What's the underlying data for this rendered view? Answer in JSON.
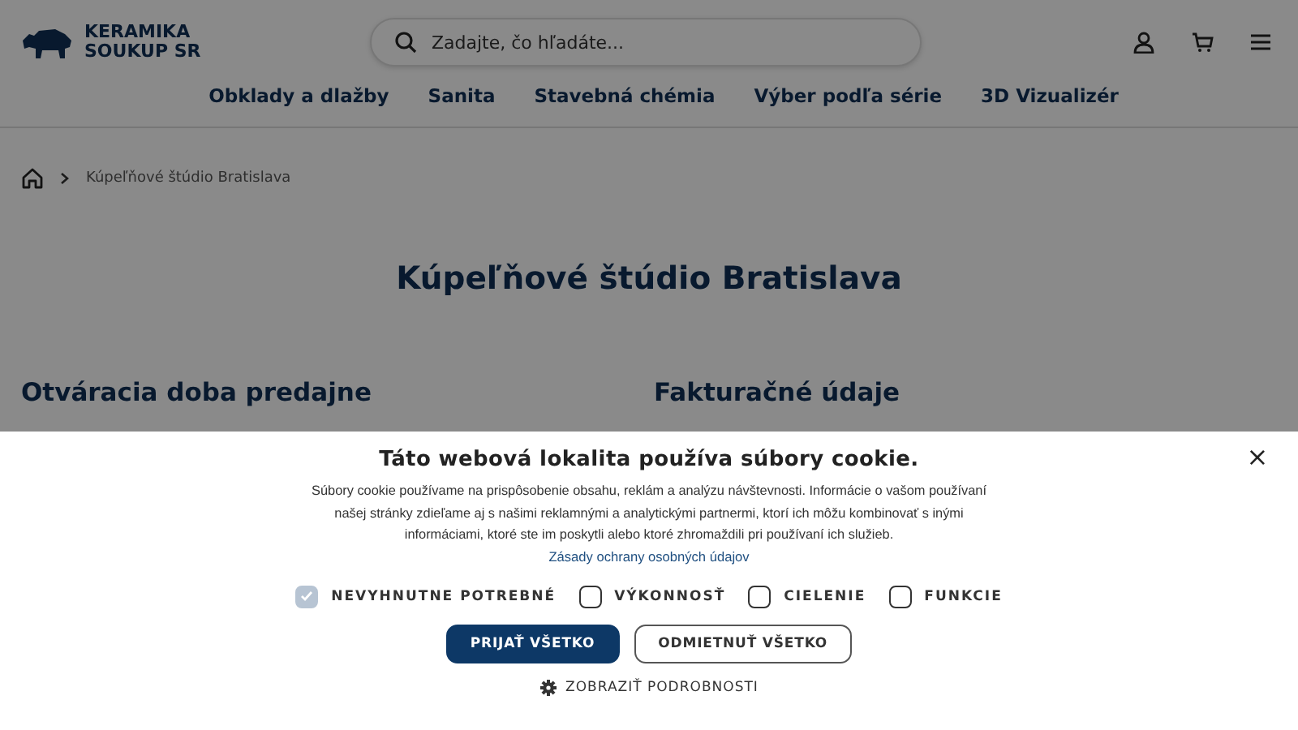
{
  "header": {
    "logo": {
      "line1": "KERAMIKA",
      "line2": "SOUKUP SR"
    },
    "search": {
      "placeholder": "Zadajte, čo hľadáte..."
    },
    "nav": [
      "Obklady a dlažby",
      "Sanita",
      "Stavebná chémia",
      "Výber podľa série",
      "3D Vizualizér"
    ]
  },
  "breadcrumb": {
    "items": [
      "Kúpeľňové štúdio Bratislava"
    ]
  },
  "page": {
    "title": "Kúpeľňové štúdio Bratislava",
    "sections": [
      "Otváracia doba predajne",
      "Fakturačné údaje"
    ]
  },
  "cookie_banner": {
    "title": "Táto webová lokalita používa súbory cookie.",
    "text": "Súbory cookie používame na prispôsobenie obsahu, reklám a analýzu návštevnosti. Informácie o vašom používaní našej stránky zdieľame aj s našimi reklamnými a analytickými partnermi, ktorí ich môžu kombinovať s inými informáciami, ktoré ste im poskytli alebo ktoré zhromaždili pri používaní ich služieb.",
    "link": "Zásady ochrany osobných údajov",
    "options": [
      {
        "label": "NEVYHNUTNE POTREBNÉ",
        "checked": true,
        "disabled": true
      },
      {
        "label": "VÝKONNOSŤ",
        "checked": false,
        "disabled": false
      },
      {
        "label": "CIELENIE",
        "checked": false,
        "disabled": false
      },
      {
        "label": "FUNKCIE",
        "checked": false,
        "disabled": false
      }
    ],
    "buttons": [
      {
        "label": "PRIJAŤ VŠETKO",
        "kind": "primary"
      },
      {
        "label": "ODMIETNUŤ VŠETKO",
        "kind": "secondary"
      }
    ],
    "details": "ZOBRAZIŤ PODROBNOSTI",
    "close": "×"
  }
}
